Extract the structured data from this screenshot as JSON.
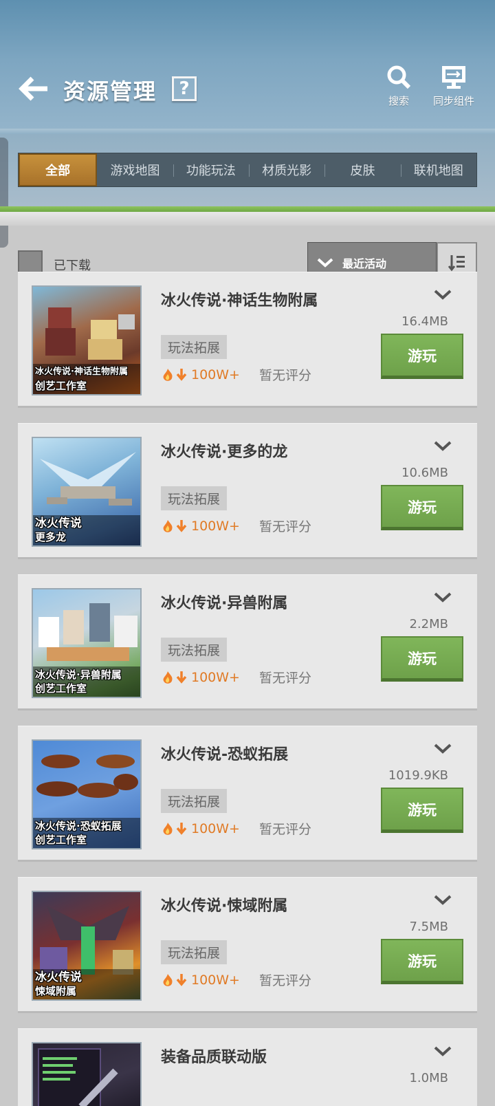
{
  "header": {
    "title": "资源管理",
    "help_label": "?",
    "search_label": "搜索",
    "sync_label": "同步组件"
  },
  "tabs": [
    {
      "label": "全部",
      "active": true
    },
    {
      "label": "游戏地图",
      "active": false
    },
    {
      "label": "功能玩法",
      "active": false
    },
    {
      "label": "材质光影",
      "active": false
    },
    {
      "label": "皮肤",
      "active": false
    },
    {
      "label": "联机地图",
      "active": false
    }
  ],
  "filter": {
    "downloaded_label": "已下载",
    "sort_label": "最近活动"
  },
  "items": [
    {
      "title": "冰火传说·神话生物附属",
      "size": "16.4MB",
      "tag": "玩法拓展",
      "downloads": "100W+",
      "rating": "暂无评分",
      "play": "游玩",
      "thumb_caption_1": "冰火传说·神话生物附属",
      "thumb_caption_2": "创艺工作室"
    },
    {
      "title": "冰火传说·更多的龙",
      "size": "10.6MB",
      "tag": "玩法拓展",
      "downloads": "100W+",
      "rating": "暂无评分",
      "play": "游玩",
      "thumb_caption_1": "冰火传说",
      "thumb_caption_2": "更多龙"
    },
    {
      "title": "冰火传说·异兽附属",
      "size": "2.2MB",
      "tag": "玩法拓展",
      "downloads": "100W+",
      "rating": "暂无评分",
      "play": "游玩",
      "thumb_caption_1": "冰火传说·异兽附属",
      "thumb_caption_2": "创艺工作室"
    },
    {
      "title": "冰火传说-恐蚁拓展",
      "size": "1019.9KB",
      "tag": "玩法拓展",
      "downloads": "100W+",
      "rating": "暂无评分",
      "play": "游玩",
      "thumb_caption_1": "冰火传说·恐蚁拓展",
      "thumb_caption_2": "创艺工作室"
    },
    {
      "title": "冰火传说·悚域附属",
      "size": "7.5MB",
      "tag": "玩法拓展",
      "downloads": "100W+",
      "rating": "暂无评分",
      "play": "游玩",
      "thumb_caption_1": "冰火传说",
      "thumb_caption_2": "悚域附属"
    },
    {
      "title": "装备品质联动版",
      "size": "1.0MB",
      "tag": "",
      "downloads": "",
      "rating": "",
      "play": "",
      "thumb_caption_1": "",
      "thumb_caption_2": ""
    }
  ],
  "colors": {
    "accent_tab": "#b8802f",
    "play_button": "#76aa50",
    "download_count": "#e07a25"
  }
}
